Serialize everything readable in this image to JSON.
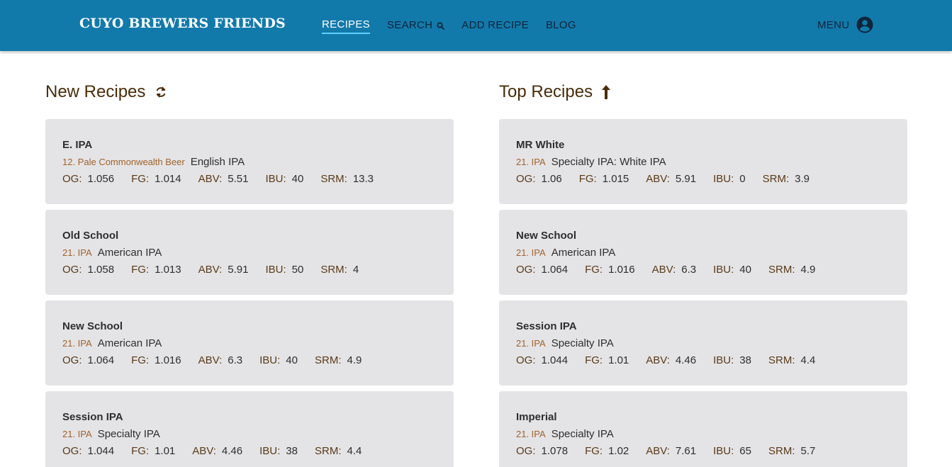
{
  "header": {
    "brand": "CUYO BREWERS FRIENDS",
    "nav": [
      {
        "label": "RECIPES",
        "active": true
      },
      {
        "label": "SEARCH",
        "icon": "search-icon"
      },
      {
        "label": "ADD RECIPE"
      },
      {
        "label": "BLOG"
      }
    ],
    "menu_label": "MENU",
    "menu_icon": "account-circle-icon"
  },
  "new_recipes": {
    "title": "New Recipes",
    "icon": "refresh-icon",
    "items": [
      {
        "name": "E. IPA",
        "style_code": "12. Pale Commonwealth Beer",
        "style_name": "English IPA",
        "og": "1.056",
        "fg": "1.014",
        "abv": "5.51",
        "ibu": "40",
        "srm": "13.3"
      },
      {
        "name": "Old School",
        "style_code": "21. IPA",
        "style_name": "American IPA",
        "og": "1.058",
        "fg": "1.013",
        "abv": "5.91",
        "ibu": "50",
        "srm": "4"
      },
      {
        "name": "New School",
        "style_code": "21. IPA",
        "style_name": "American IPA",
        "og": "1.064",
        "fg": "1.016",
        "abv": "6.3",
        "ibu": "40",
        "srm": "4.9"
      },
      {
        "name": "Session IPA",
        "style_code": "21. IPA",
        "style_name": "Specialty IPA",
        "og": "1.044",
        "fg": "1.01",
        "abv": "4.46",
        "ibu": "38",
        "srm": "4.4"
      }
    ]
  },
  "top_recipes": {
    "title": "Top Recipes",
    "icon": "arrow-up-icon",
    "items": [
      {
        "name": "MR White",
        "style_code": "21. IPA",
        "style_name": "Specialty IPA: White IPA",
        "og": "1.06",
        "fg": "1.015",
        "abv": "5.91",
        "ibu": "0",
        "srm": "3.9"
      },
      {
        "name": "New School",
        "style_code": "21. IPA",
        "style_name": "American IPA",
        "og": "1.064",
        "fg": "1.016",
        "abv": "6.3",
        "ibu": "40",
        "srm": "4.9"
      },
      {
        "name": "Session IPA",
        "style_code": "21. IPA",
        "style_name": "Specialty IPA",
        "og": "1.044",
        "fg": "1.01",
        "abv": "4.46",
        "ibu": "38",
        "srm": "4.4"
      },
      {
        "name": "Imperial",
        "style_code": "21. IPA",
        "style_name": "Specialty IPA",
        "og": "1.078",
        "fg": "1.02",
        "abv": "7.61",
        "ibu": "65",
        "srm": "5.7"
      }
    ]
  },
  "stat_labels": {
    "og": "OG:",
    "fg": "FG:",
    "abv": "ABV:",
    "ibu": "IBU:",
    "srm": "SRM:"
  },
  "colors": {
    "header_bg": "#127aab",
    "accent_underline": "#5fd0ff",
    "card_bg": "#e4e4e6",
    "heading": "#4a2c0a",
    "style_code": "#a0622c"
  }
}
